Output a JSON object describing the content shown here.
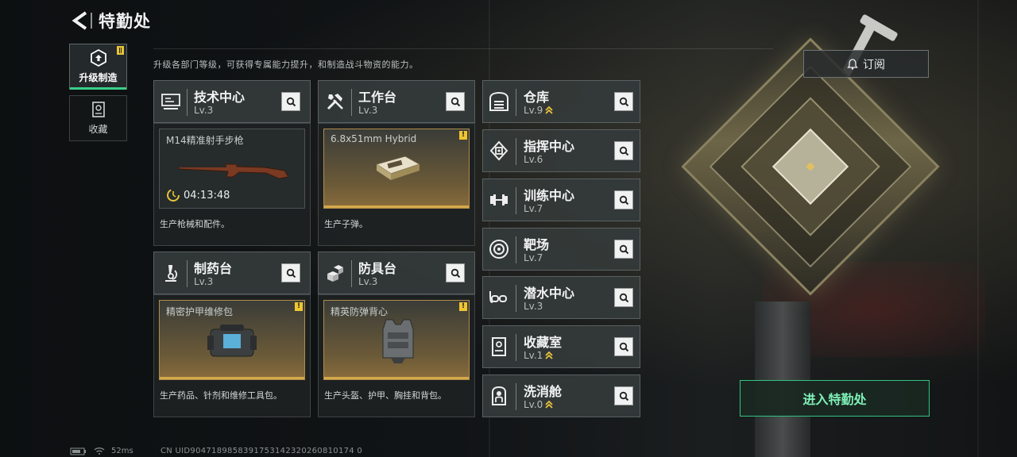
{
  "header": {
    "title": "特勤处"
  },
  "tabs": [
    {
      "label": "升级制造",
      "active": true,
      "icon": "upgrade-icon"
    },
    {
      "label": "收藏",
      "active": false,
      "icon": "collection-icon"
    }
  ],
  "description": "升级各部门等级，可获得专属能力提升，和制造战斗物资的能力。",
  "subscribe_label": "订阅",
  "enter_label": "进入特勤处",
  "departments": [
    {
      "name": "技术中心",
      "level": "Lv.3",
      "icon": "computer-icon",
      "product": {
        "title": "M14精准射手步枪",
        "timer": "04:13:48",
        "desc": "生产枪械和配件。",
        "ready": false
      }
    },
    {
      "name": "工作台",
      "level": "Lv.3",
      "icon": "tools-icon",
      "product": {
        "title": "6.8x51mm Hybrid",
        "desc": "生产子弹。",
        "ready": true
      }
    },
    {
      "name": "制药台",
      "level": "Lv.3",
      "icon": "microscope-icon",
      "product": {
        "title": "精密护甲维修包",
        "desc": "生产药品、针剂和维修工具包。",
        "ready": true
      }
    },
    {
      "name": "防具台",
      "level": "Lv.3",
      "icon": "armor-boxes-icon",
      "product": {
        "title": "精英防弹背心",
        "desc": "生产头盔、护甲、胸挂和背包。",
        "ready": true
      }
    }
  ],
  "facilities": [
    {
      "name": "仓库",
      "level": "Lv.9",
      "upgradable": true,
      "icon": "warehouse-icon"
    },
    {
      "name": "指挥中心",
      "level": "Lv.6",
      "upgradable": false,
      "icon": "chip-icon"
    },
    {
      "name": "训练中心",
      "level": "Lv.7",
      "upgradable": false,
      "icon": "dumbbell-icon"
    },
    {
      "name": "靶场",
      "level": "Lv.7",
      "upgradable": false,
      "icon": "target-icon"
    },
    {
      "name": "潜水中心",
      "level": "Lv.3",
      "upgradable": false,
      "icon": "goggles-icon"
    },
    {
      "name": "收藏室",
      "level": "Lv.1",
      "upgradable": true,
      "icon": "display-case-icon"
    },
    {
      "name": "洗消舱",
      "level": "Lv.0",
      "upgradable": true,
      "icon": "decon-pod-icon"
    }
  ],
  "footer": {
    "ping": "52ms",
    "uid": "CN UID9047189858391753142320260810174 0"
  },
  "colors": {
    "accent_green": "#3ad08b",
    "warn_yellow": "#f0c52f",
    "gold": "#d4a94a"
  }
}
